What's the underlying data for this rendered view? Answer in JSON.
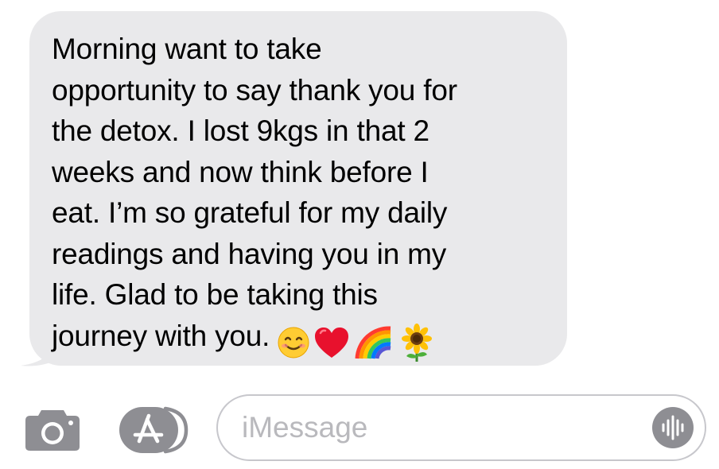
{
  "message": {
    "lines": [
      "Morning want to take",
      "opportunity to say thank you for",
      "the detox. I lost 9kgs in that 2",
      "weeks and now think before I",
      "eat. I’m so grateful for my daily",
      "readings and having you in my",
      "life. Glad to be taking this",
      "journey with you."
    ],
    "emojis": [
      "smiling-face-emoji",
      "red-heart-emoji",
      "rainbow-emoji",
      "sunflower-emoji"
    ],
    "bubble_color": "#e9e9eb",
    "text_color": "#000000"
  },
  "composer": {
    "placeholder": "iMessage",
    "camera_icon": "camera-icon",
    "apps_icon": "app-store-icon",
    "audio_icon": "audio-waveform-icon",
    "icon_color": "#8e8e93",
    "border_color": "#c7c7cc"
  }
}
